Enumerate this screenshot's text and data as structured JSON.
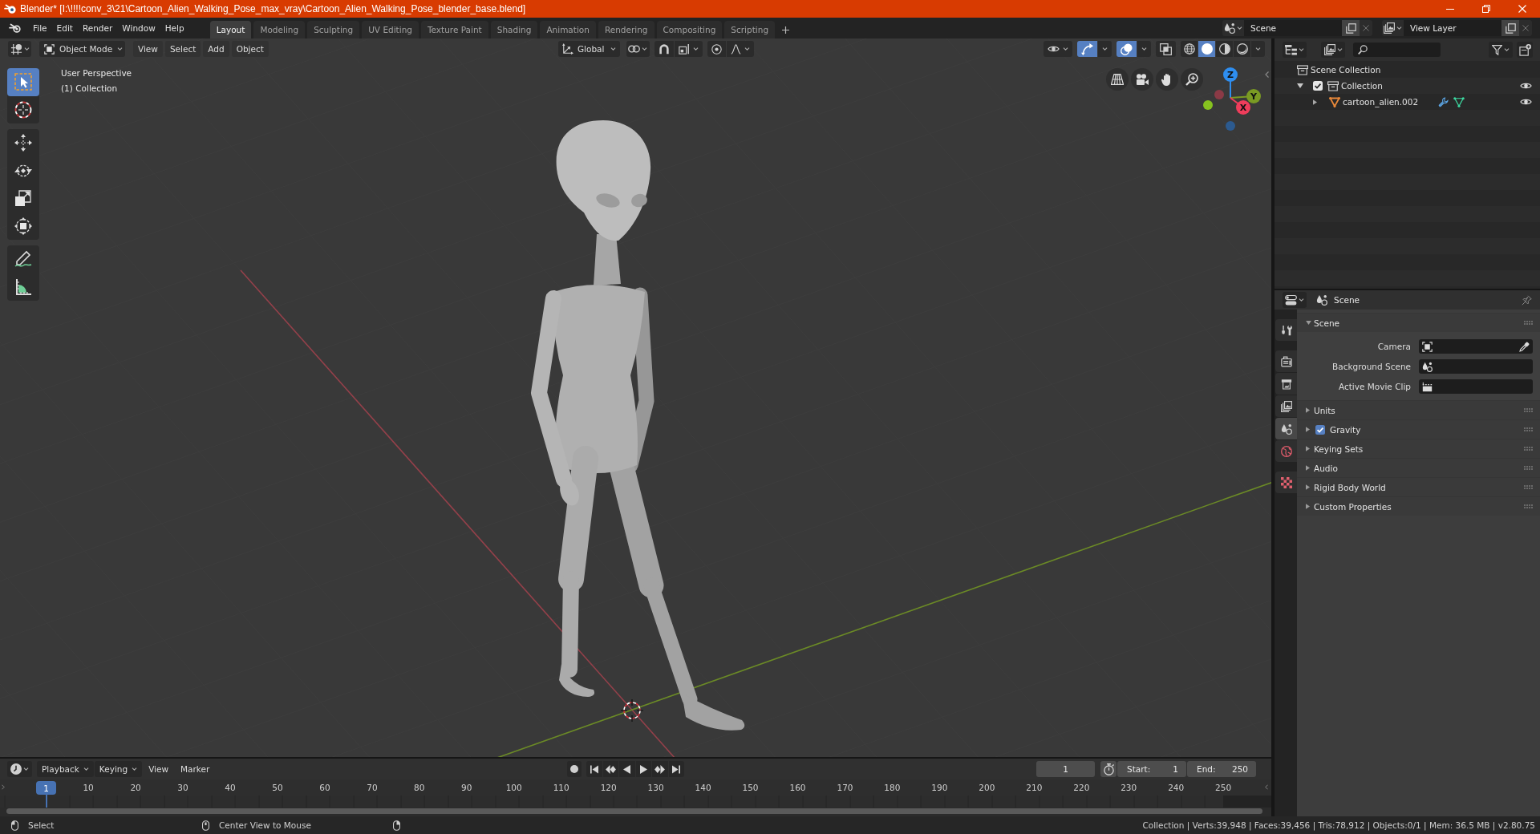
{
  "window": {
    "title": "Blender* [I:\\!!!!conv_3\\21\\Cartoon_Alien_Walking_Pose_max_vray\\Cartoon_Alien_Walking_Pose_blender_base.blend]"
  },
  "menu": [
    "File",
    "Edit",
    "Render",
    "Window",
    "Help"
  ],
  "workspaces": [
    {
      "label": "Layout",
      "selected": true
    },
    {
      "label": "Modeling",
      "selected": false
    },
    {
      "label": "Sculpting",
      "selected": false
    },
    {
      "label": "UV Editing",
      "selected": false
    },
    {
      "label": "Texture Paint",
      "selected": false
    },
    {
      "label": "Shading",
      "selected": false
    },
    {
      "label": "Animation",
      "selected": false
    },
    {
      "label": "Rendering",
      "selected": false
    },
    {
      "label": "Compositing",
      "selected": false
    },
    {
      "label": "Scripting",
      "selected": false
    }
  ],
  "scene_selector": {
    "value": "Scene"
  },
  "view_layer_selector": {
    "value": "View Layer"
  },
  "viewport": {
    "mode": "Object Mode",
    "menus": [
      "View",
      "Select",
      "Add",
      "Object"
    ],
    "orientation": "Global",
    "toggles": [
      {
        "kind": "gizmos",
        "on": true
      },
      {
        "kind": "overlays",
        "on": true
      },
      {
        "kind": "xray",
        "on": false
      }
    ],
    "shading": [
      {
        "kind": "wireframe",
        "selected": false
      },
      {
        "kind": "solid",
        "selected": true
      },
      {
        "kind": "material",
        "selected": false
      },
      {
        "kind": "rendered",
        "selected": false
      }
    ],
    "toolbar": [
      {
        "tools": [
          {
            "kind": "select-box",
            "selected": true
          },
          {
            "kind": "cursor",
            "selected": false
          }
        ]
      },
      {
        "tools": [
          {
            "kind": "move",
            "selected": false
          },
          {
            "kind": "rotate",
            "selected": false
          },
          {
            "kind": "scale",
            "selected": false
          },
          {
            "kind": "transform",
            "selected": false
          }
        ]
      },
      {
        "tools": [
          {
            "kind": "annotate",
            "selected": false
          },
          {
            "kind": "measure",
            "selected": false
          }
        ]
      }
    ],
    "view_name": "User Perspective",
    "collection_label": "(1) Collection",
    "gizmo_axes": [
      {
        "label": "Z",
        "color": "#2e8ef0"
      },
      {
        "label": "Y",
        "color": "#7a9a23"
      },
      {
        "label": "X",
        "color": "#ef3d5b"
      }
    ]
  },
  "outliner": {
    "tree": [
      {
        "label": "Scene Collection",
        "kind": "scene-collection",
        "children": [
          {
            "label": "Collection",
            "kind": "collection",
            "expanded": true,
            "checked": true,
            "visible": true,
            "children": [
              {
                "label": "cartoon_alien.002",
                "kind": "mesh-object",
                "expanded": false,
                "visible": true
              }
            ]
          }
        ]
      }
    ]
  },
  "properties": {
    "context": "Scene",
    "tab_groups": [
      {
        "tabs": [
          {
            "kind": "tool",
            "selected": false
          }
        ]
      },
      {
        "tabs": [
          {
            "kind": "render",
            "selected": false
          },
          {
            "kind": "output",
            "selected": false
          },
          {
            "kind": "view-layer",
            "selected": false
          },
          {
            "kind": "scene",
            "selected": true
          },
          {
            "kind": "world",
            "selected": false
          }
        ]
      },
      {
        "tabs": [
          {
            "kind": "texture",
            "selected": false
          }
        ]
      }
    ],
    "panels": [
      {
        "title": "Scene",
        "expanded": true,
        "fields": [
          {
            "label": "Camera",
            "kind": "camera"
          },
          {
            "label": "Background Scene",
            "kind": "scene"
          },
          {
            "label": "Active Movie Clip",
            "kind": "movie-clip"
          }
        ]
      },
      {
        "title": "Units",
        "expanded": false
      },
      {
        "title": "Gravity",
        "expanded": false,
        "checked": true
      },
      {
        "title": "Keying Sets",
        "expanded": false
      },
      {
        "title": "Audio",
        "expanded": false
      },
      {
        "title": "Rigid Body World",
        "expanded": false
      },
      {
        "title": "Custom Properties",
        "expanded": false
      }
    ]
  },
  "timeline": {
    "menus": [
      {
        "label": "Playback",
        "kind": "dropdown"
      },
      {
        "label": "Keying",
        "kind": "dropdown"
      },
      {
        "label": "View",
        "kind": "menu"
      },
      {
        "label": "Marker",
        "kind": "menu"
      }
    ],
    "current_frame": "1",
    "start": {
      "label": "Start:",
      "value": "1"
    },
    "end": {
      "label": "End:",
      "value": "250"
    },
    "ruler": {
      "current": "1",
      "labels": [
        "10",
        "20",
        "30",
        "40",
        "50",
        "60",
        "70",
        "80",
        "90",
        "100",
        "110",
        "120",
        "130",
        "140",
        "150",
        "160",
        "170",
        "180",
        "190",
        "200",
        "210",
        "220",
        "230",
        "240",
        "250"
      ]
    }
  },
  "status_bar": {
    "hints": [
      {
        "kind": "left-click",
        "label": "Select"
      },
      {
        "kind": "middle-click",
        "label": "Center View to Mouse"
      },
      {
        "kind": "right-click"
      }
    ],
    "stats": "Collection | Verts:39,948 | Faces:39,456 | Tris:78,912 | Objects:0/1 | Mem: 36.5 MB | v2.80.75"
  }
}
